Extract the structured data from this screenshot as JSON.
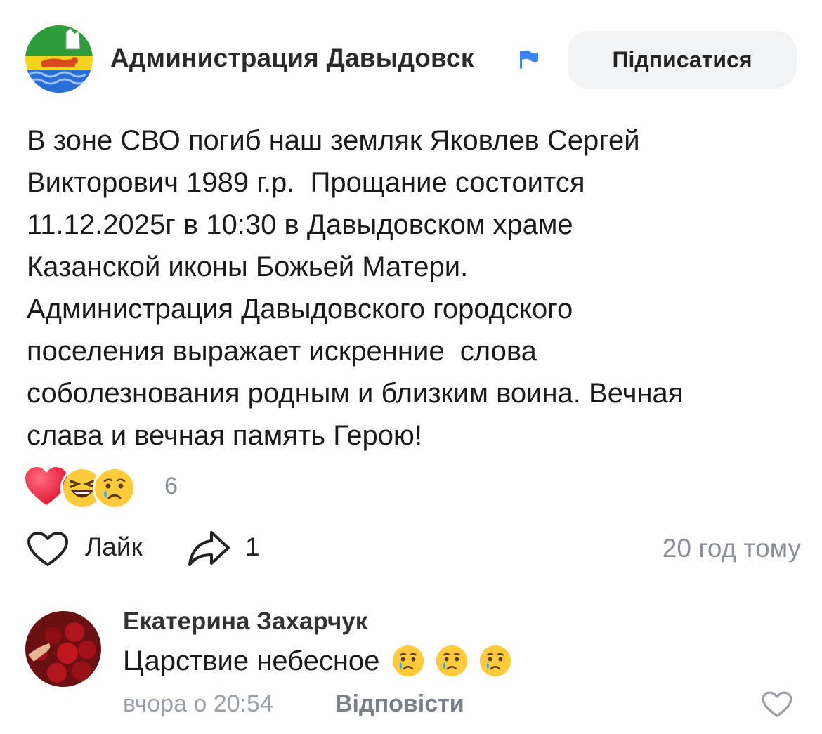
{
  "post": {
    "author": "Администрация Давыдовск",
    "subscribe_label": "Підписатися",
    "text": "В зоне СВО погиб наш земляк Яковлев Сергей\nВикторович 1989 г.р.  Прощание состоится\n11.12.2025г в 10:30 в Давыдовском храме\nКазанской иконы Божьей Матери.\nАдминистрация Давыдовского городского\nпоселения выражает искренние  слова\nсоболезнования родным и близким воина. Вечная\nслава и вечная память Герою!",
    "reactions": {
      "icons": [
        "heart-icon",
        "laughing-emoji-icon",
        "crying-emoji-icon"
      ],
      "count": "6"
    },
    "like_label": "Лайк",
    "share_count": "1",
    "time": "20 год тому"
  },
  "comment": {
    "author": "Екатерина Захарчук",
    "text": "Царствие небесное",
    "emojis": [
      "crying-emoji-icon",
      "crying-emoji-icon",
      "crying-emoji-icon"
    ],
    "time": "вчора о 20:54",
    "reply_label": "Відповісти"
  },
  "colors": {
    "subscribe_bg": "#f2f3f5",
    "muted_text": "#8a8f98",
    "verified_flag": "#3b82f6"
  }
}
